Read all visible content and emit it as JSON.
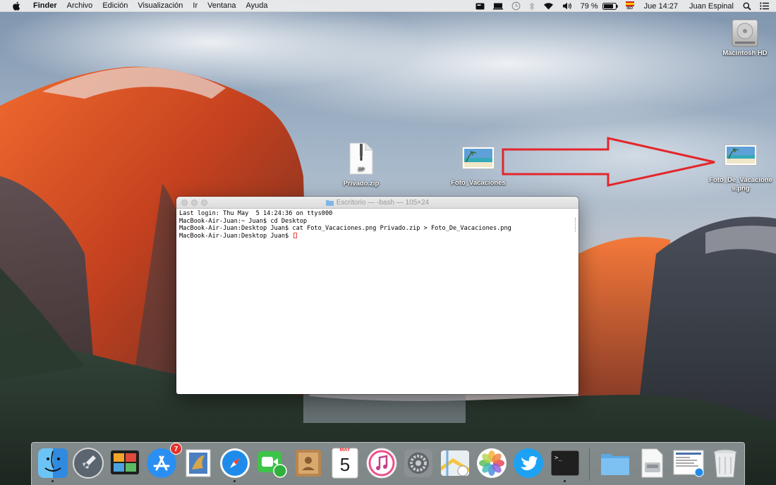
{
  "menubar": {
    "app": "Finder",
    "items": [
      "Archivo",
      "Edición",
      "Visualización",
      "Ir",
      "Ventana",
      "Ayuda"
    ],
    "status": {
      "battery": "79 %",
      "input_source": "ISO",
      "clock": "Jue 14:27",
      "user": "Juan Espinal"
    }
  },
  "desktop": {
    "icons": [
      {
        "name": "Macintosh HD",
        "kind": "hard-drive-icon"
      },
      {
        "name": "Privado.zip",
        "kind": "zip-file-icon",
        "badge": "ZIP"
      },
      {
        "name": "Foto_Vacaciones",
        "kind": "image-file-icon"
      },
      {
        "name_line1": "Foto_De_Vacacione",
        "name_line2": "s.png",
        "kind": "image-file-icon"
      }
    ]
  },
  "terminal": {
    "title": "Escritorio — -bash — 105×24",
    "lines": [
      "Last login: Thu May  5 14:24:36 on ttys000",
      "MacBook-Air-Juan:~ Juan$ cd Desktop",
      "MacBook-Air-Juan:Desktop Juan$ cat Foto_Vacaciones.png Privado.zip > Foto_De_Vacaciones.png",
      "MacBook-Air-Juan:Desktop Juan$ "
    ]
  },
  "dock": {
    "app_store_badge": "7",
    "calendar_month": "MAY",
    "calendar_day": "5",
    "terminal_glyph": ">_"
  },
  "colors": {
    "annotation_red": "#e3262b",
    "sky": "#9fb3c8"
  }
}
